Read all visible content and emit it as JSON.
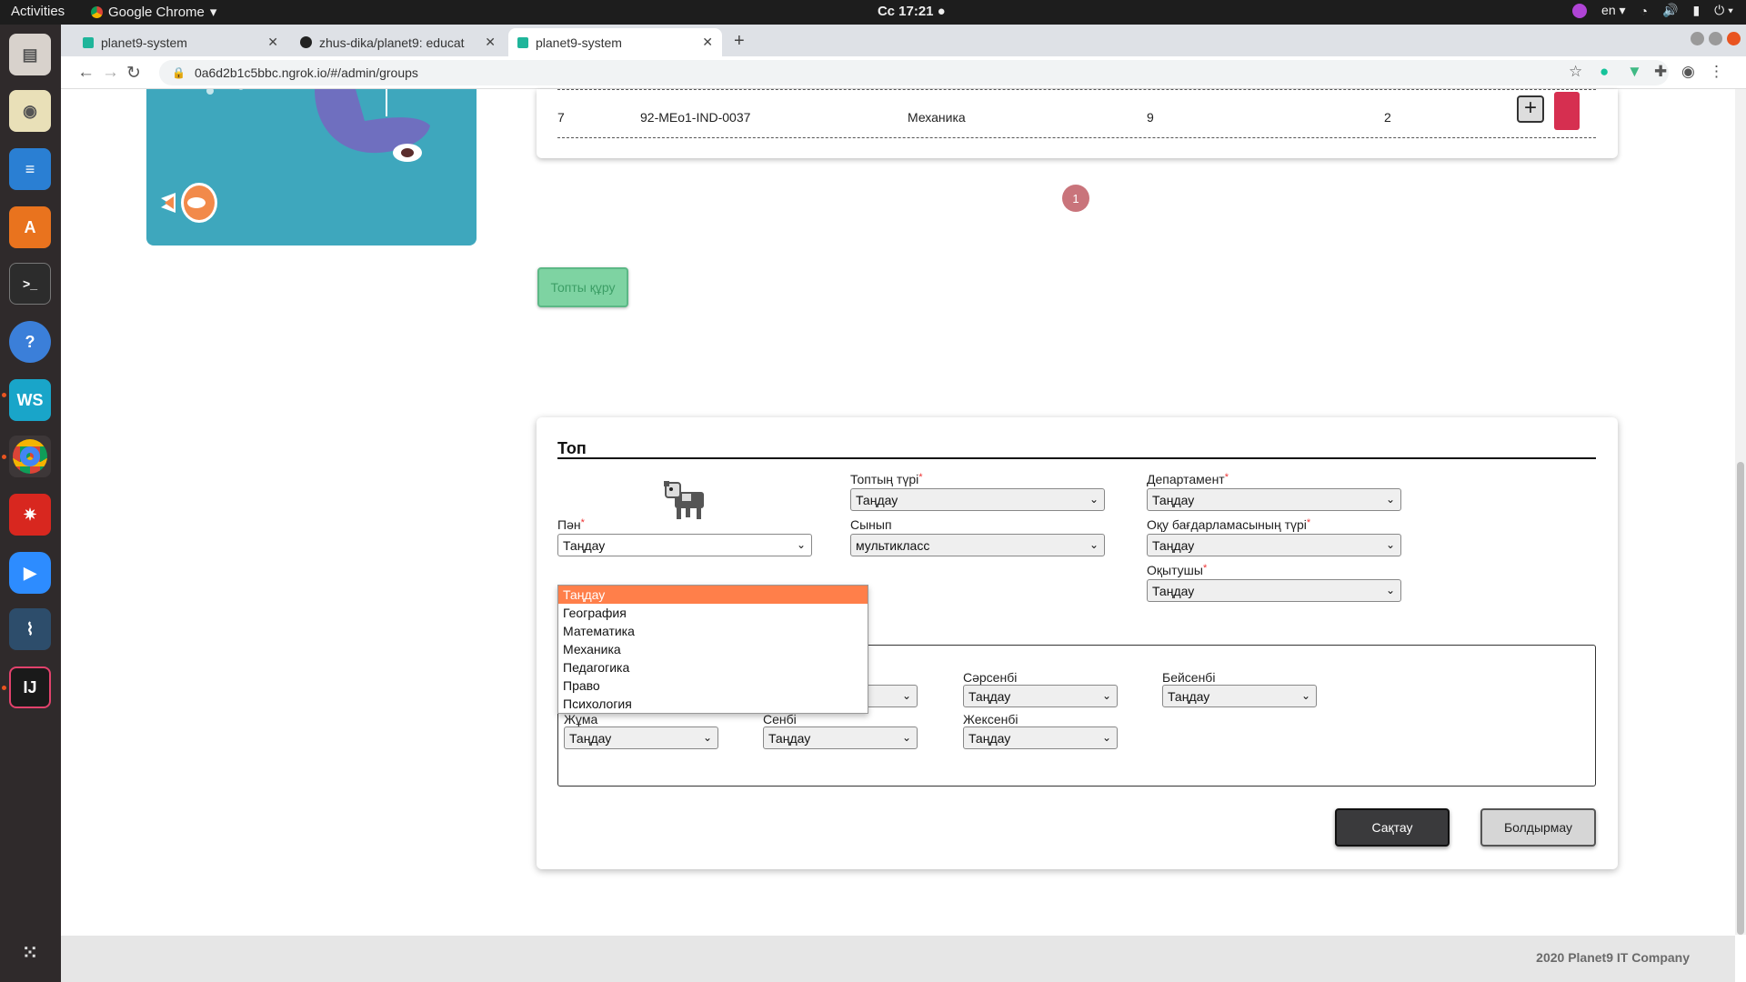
{
  "os": {
    "activities": "Activities",
    "app_name": "Google Chrome",
    "clock": "Сс 17:21",
    "language": "en"
  },
  "browser": {
    "tabs": [
      {
        "title": "planet9-system"
      },
      {
        "title": "zhus-dika/planet9: educat"
      },
      {
        "title": "planet9-system"
      }
    ],
    "url": "0a6d2b1c5bbc.ngrok.io/#/admin/groups"
  },
  "groups_table": {
    "row": {
      "index": "7",
      "code": "92-MEo1-IND-0037",
      "subject": "Механика",
      "class": "9",
      "count": "2"
    }
  },
  "pagination": {
    "current_page": "1"
  },
  "create_button": "Топты құру",
  "modal": {
    "title": "Топ",
    "group_type_label": "Топтың түрі",
    "group_type_value": "Таңдау",
    "department_label": "Департамент",
    "department_value": "Таңдау",
    "subject_label": "Пән",
    "subject_value": "Таңдау",
    "class_label": "Сынып",
    "class_value": "мультикласс",
    "program_type_label": "Оқу бағдарламасының түрі",
    "program_type_value": "Таңдау",
    "teacher_label": "Оқытушы",
    "teacher_value": "Таңдау",
    "schedule": {
      "wednesday_label": "Сәрсенбі",
      "wednesday_value": "Таңдау",
      "thursday_label": "Бейсенбі",
      "thursday_value": "Таңдау",
      "friday_label": "Жұма",
      "friday_value": "Таңдау",
      "saturday_label": "Сенбі",
      "saturday_value": "Таңдау",
      "sunday_label": "Жексенбі",
      "sunday_value": "Таңдау"
    },
    "subject_options": [
      "Таңдау",
      "География",
      "Математика",
      "Механика",
      "Педагогика",
      "Право",
      "Психология"
    ],
    "save_label": "Сақтау",
    "cancel_label": "Болдырмау"
  },
  "footer": {
    "text": "2020 Planet9 IT Company"
  },
  "colors": {
    "accent_orange": "#ff7f4a",
    "create_green": "#7ed3a2",
    "pager_red": "#c9747b",
    "hero_teal": "#3ea7bd"
  }
}
